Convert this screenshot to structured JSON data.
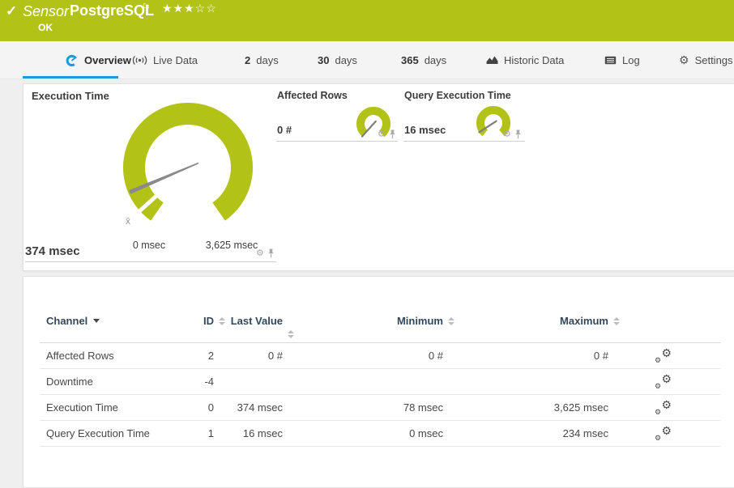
{
  "icons": {
    "gear": "⚙",
    "check": "✓",
    "flag": "⚐",
    "stars": "★★★☆☆"
  },
  "header": {
    "kind": "Sensor",
    "name": "PostgreSQL",
    "status": "OK",
    "priority_stars": "★★★☆☆",
    "priority_filled": 3,
    "priority_total": 5
  },
  "tabs": [
    {
      "label": "Overview",
      "active": true
    },
    {
      "label": "Live Data"
    },
    {
      "num": "2",
      "label": "days"
    },
    {
      "num": "30",
      "label": "days"
    },
    {
      "num": "365",
      "label": "days"
    },
    {
      "label": "Historic Data"
    },
    {
      "label": "Log"
    },
    {
      "label": "Settings"
    }
  ],
  "gauges": {
    "primary": {
      "title": "Execution Time",
      "value": "374 msec",
      "value_num": 374,
      "min_label": "0 msec",
      "max_label": "3,625 msec",
      "min_num": 0,
      "max_num": 3625,
      "avg_marker": "x̄"
    },
    "affected_rows": {
      "title": "Affected Rows",
      "value": "0 #"
    },
    "query_execution_time": {
      "title": "Query Execution Time",
      "value": "16 msec"
    }
  },
  "table": {
    "headers": {
      "channel": "Channel",
      "id": "ID",
      "last_value": "Last Value",
      "minimum": "Minimum",
      "maximum": "Maximum"
    },
    "rows": [
      {
        "channel": "Affected Rows",
        "id": "2",
        "last": "0 #",
        "min": "0 #",
        "max": "0 #"
      },
      {
        "channel": "Downtime",
        "id": "-4",
        "last": "",
        "min": "",
        "max": ""
      },
      {
        "channel": "Execution Time",
        "id": "0",
        "last": "374 msec",
        "min": "78 msec",
        "max": "3,625 msec"
      },
      {
        "channel": "Query Execution Time",
        "id": "1",
        "last": "16 msec",
        "min": "0 msec",
        "max": "234 msec"
      }
    ]
  },
  "colors": {
    "brand_green": "#b3c217",
    "accent_blue": "#1f9ad6",
    "needle_gray": "#8a8a8a"
  }
}
